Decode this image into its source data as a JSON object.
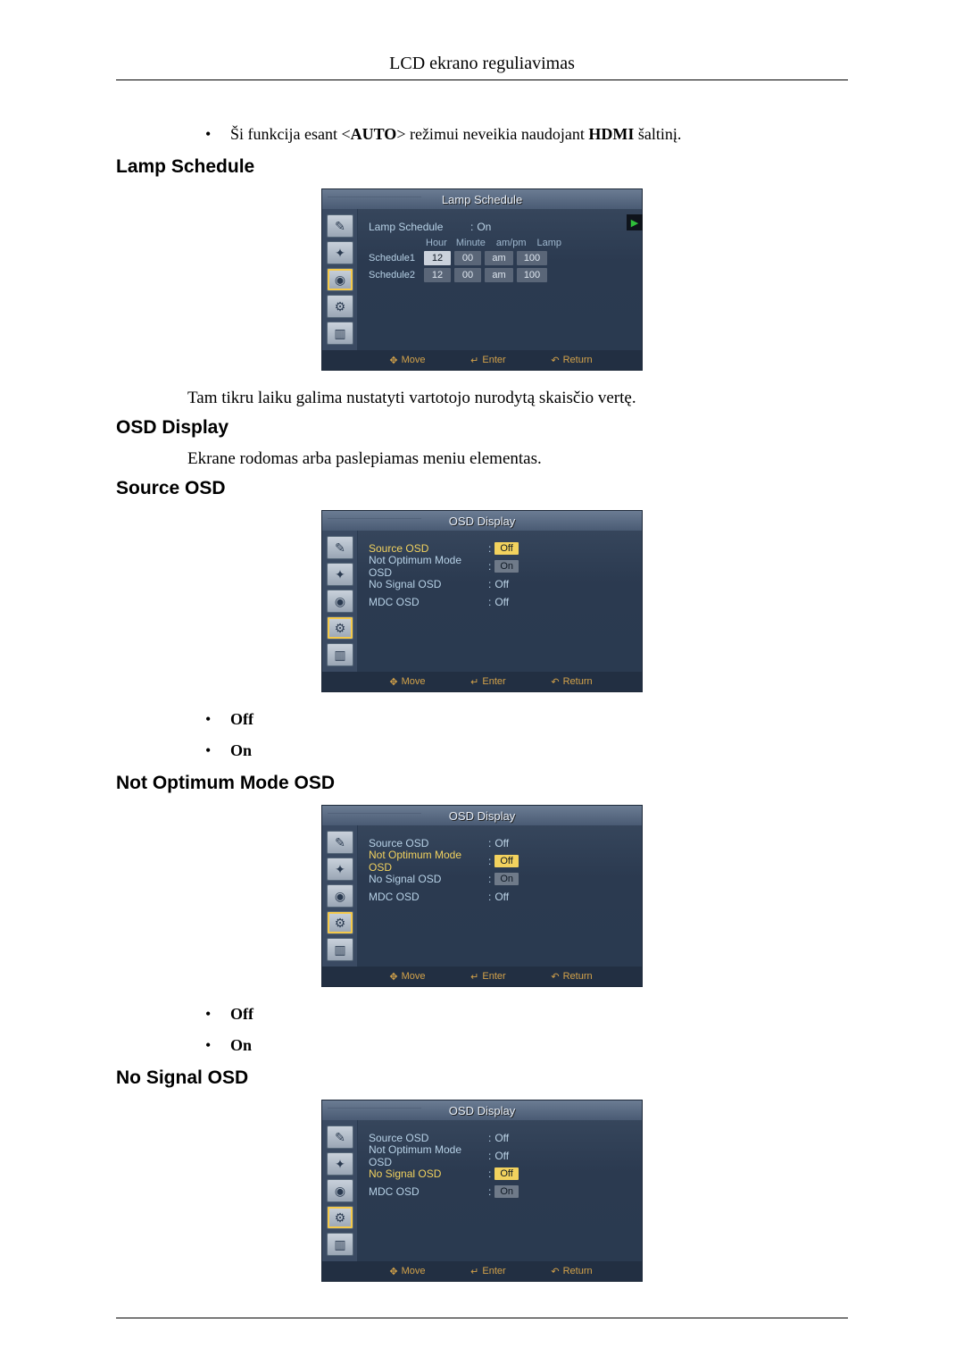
{
  "header": {
    "title": "LCD ekrano reguliavimas"
  },
  "intro_note": {
    "prefix": "Ši funkcija esant <",
    "auto": "AUTO",
    "mid": "> režimui neveikia naudojant ",
    "hdmi": "HDMI",
    "suffix": " šaltinį."
  },
  "sections": {
    "lamp_schedule": "Lamp Schedule",
    "osd_display": "OSD Display",
    "source_osd": "Source OSD",
    "not_optimum": "Not Optimum Mode OSD",
    "no_signal": "No Signal OSD"
  },
  "body": {
    "lamp_schedule_desc": "Tam tikru laiku galima nustatyti vartotojo nurodytą skaisčio vertę.",
    "osd_display_desc": "Ekrane rodomas arba paslepiamas meniu elementas."
  },
  "bullets": {
    "off": "Off",
    "on": "On"
  },
  "osd_common": {
    "title_lamp": "Lamp Schedule",
    "title_osd": "OSD Display",
    "footer_move": "Move",
    "footer_enter": "Enter",
    "footer_return": "Return",
    "icons": [
      "brush",
      "arrow",
      "clock",
      "gear",
      "chart"
    ]
  },
  "lamp_panel": {
    "row_label": "Lamp Schedule",
    "row_value": "On",
    "cols": [
      "Hour",
      "Minute",
      "am/pm",
      "Lamp"
    ],
    "rows": [
      {
        "label": "Schedule1",
        "hour": "12",
        "minute": "00",
        "ampm": "am",
        "lamp": "100"
      },
      {
        "label": "Schedule2",
        "hour": "12",
        "minute": "00",
        "ampm": "am",
        "lamp": "100"
      }
    ]
  },
  "osd_items": {
    "source": "Source OSD",
    "not_optimum": "Not Optimum Mode OSD",
    "no_signal": "No Signal OSD",
    "mdc": "MDC OSD",
    "val_off": "Off",
    "val_on": "On"
  },
  "chart_data": {
    "type": "table",
    "title": "Lamp Schedule settings",
    "columns": [
      "Schedule",
      "Hour",
      "Minute",
      "am/pm",
      "Lamp"
    ],
    "rows": [
      [
        "Schedule1",
        12,
        0,
        "am",
        100
      ],
      [
        "Schedule2",
        12,
        0,
        "am",
        100
      ]
    ]
  }
}
